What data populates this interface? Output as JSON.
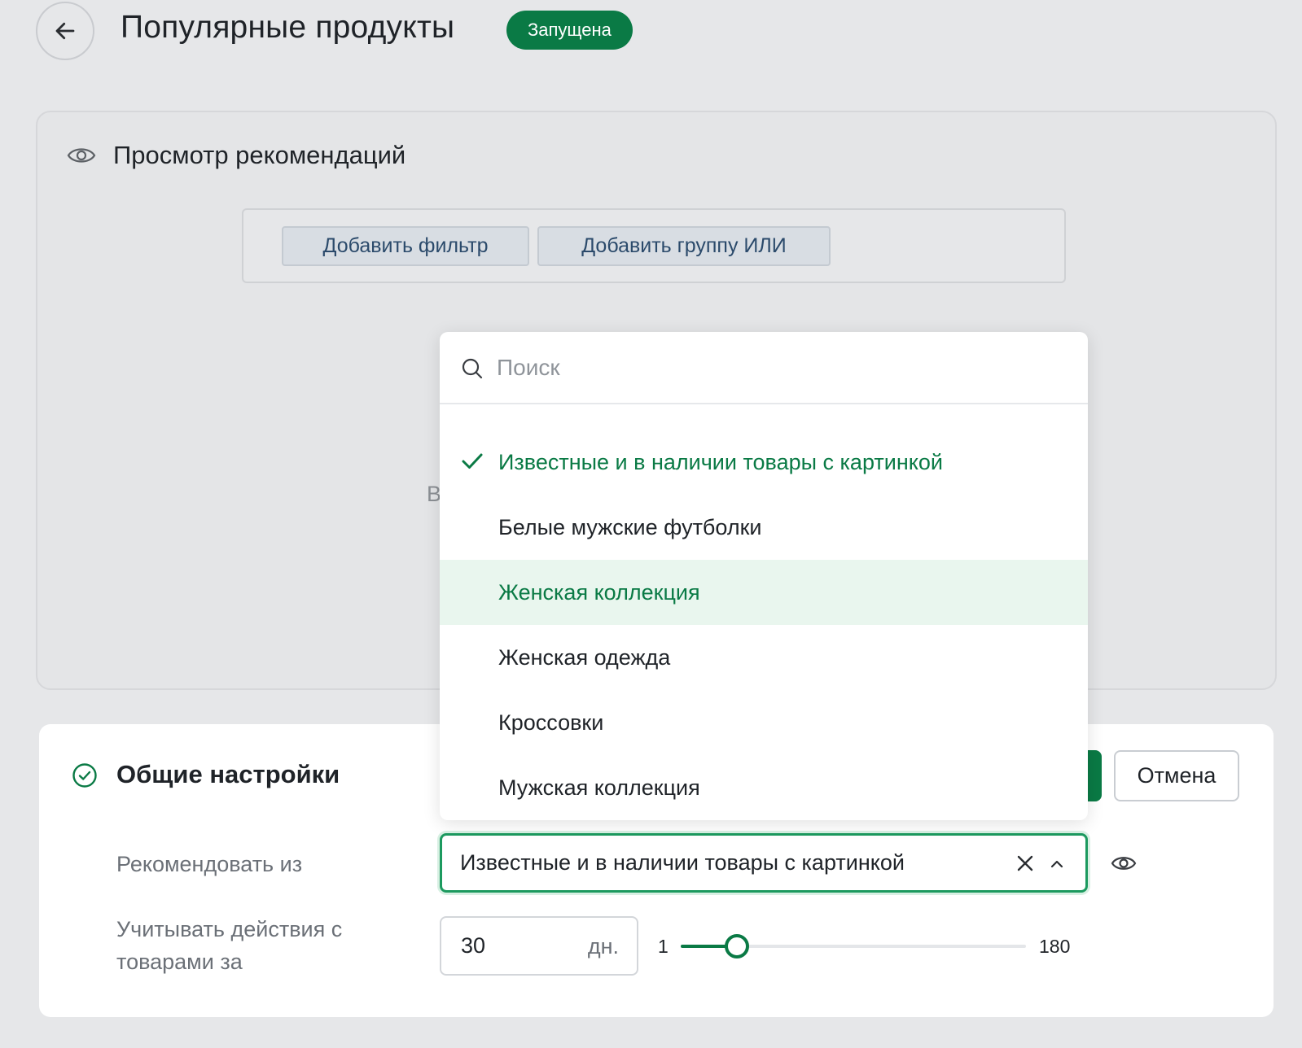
{
  "header": {
    "title": "Популярные продукты",
    "status": "Запущена"
  },
  "preview": {
    "title": "Просмотр рекомендаций",
    "add_filter_label": "Добавить фильтр",
    "add_or_group_label": "Добавить группу ИЛИ",
    "faded_text": "В"
  },
  "settings": {
    "title": "Общие настройки",
    "cancel_label": "Отмена",
    "recommend_from_label": "Рекомендовать из",
    "recommend_from_value": "Известные и в наличии товары с картинкой",
    "actions_label_line1": "Учитывать действия с",
    "actions_label_line2": "товарами за",
    "days_value": "30",
    "days_unit": "дн.",
    "slider": {
      "min": 1,
      "max": 180,
      "value": 30,
      "min_label": "1",
      "max_label": "180"
    }
  },
  "dropdown": {
    "search_placeholder": "Поиск",
    "items": [
      {
        "label": "Известные и в наличии товары с картинкой",
        "state": "selected"
      },
      {
        "label": "Белые мужские футболки",
        "state": "normal"
      },
      {
        "label": "Женская коллекция",
        "state": "hovered"
      },
      {
        "label": "Женская одежда",
        "state": "normal"
      },
      {
        "label": "Кроссовки",
        "state": "normal"
      },
      {
        "label": "Мужская коллекция",
        "state": "normal"
      }
    ]
  },
  "colors": {
    "accent": "#0a7a45",
    "hover_bg": "#e9f6ee",
    "page_bg": "#e6e7e9"
  },
  "icons": {
    "back": "arrow-left-icon",
    "preview": "eye-icon",
    "settings": "check-circle-icon",
    "search": "search-icon",
    "selected": "check-icon",
    "clear": "close-icon",
    "collapse": "chevron-up-icon",
    "select_preview": "eye-icon"
  }
}
